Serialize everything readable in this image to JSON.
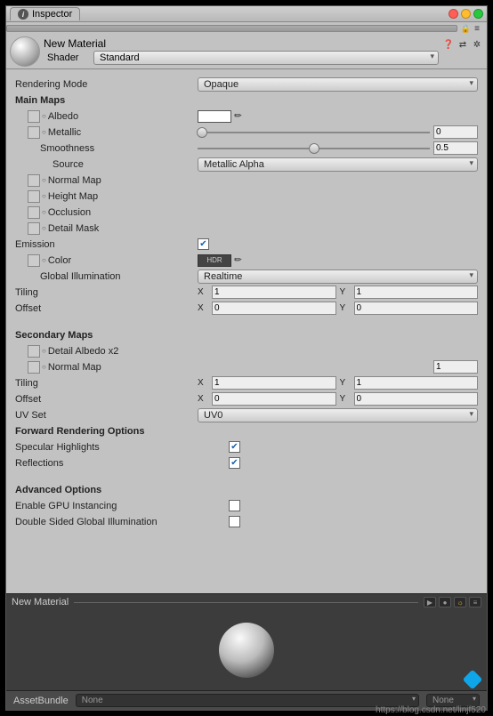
{
  "tab_title": "Inspector",
  "material_name": "New Material",
  "shader_label": "Shader",
  "shader_value": "Standard",
  "rendering_mode_label": "Rendering Mode",
  "rendering_mode_value": "Opaque",
  "main_maps_label": "Main Maps",
  "albedo_label": "Albedo",
  "metallic_label": "Metallic",
  "metallic_value": "0",
  "smoothness_label": "Smoothness",
  "smoothness_value": "0.5",
  "source_label": "Source",
  "source_value": "Metallic Alpha",
  "normal_map_label": "Normal Map",
  "height_map_label": "Height Map",
  "occlusion_label": "Occlusion",
  "detail_mask_label": "Detail Mask",
  "emission_label": "Emission",
  "color_label": "Color",
  "hdr_text": "HDR",
  "gi_label": "Global Illumination",
  "gi_value": "Realtime",
  "tiling_label": "Tiling",
  "tiling_x": "1",
  "tiling_y": "1",
  "offset_label": "Offset",
  "offset_x": "0",
  "offset_y": "0",
  "secondary_label": "Secondary Maps",
  "detail_albedo_label": "Detail Albedo x2",
  "normal_map2_label": "Normal Map",
  "normal_map2_value": "1",
  "tiling2_x": "1",
  "tiling2_y": "1",
  "offset2_x": "0",
  "offset2_y": "0",
  "uvset_label": "UV Set",
  "uvset_value": "UV0",
  "forward_label": "Forward Rendering Options",
  "specular_label": "Specular Highlights",
  "reflections_label": "Reflections",
  "advanced_label": "Advanced Options",
  "gpu_label": "Enable GPU Instancing",
  "doublesided_label": "Double Sided Global Illumination",
  "preview_title": "New Material",
  "assetbundle_label": "AssetBundle",
  "assetbundle_value": "None",
  "assetbundle_variant": "None",
  "x_label": "X",
  "y_label": "Y",
  "watermark": "https://blog.csdn.net/linjf520"
}
